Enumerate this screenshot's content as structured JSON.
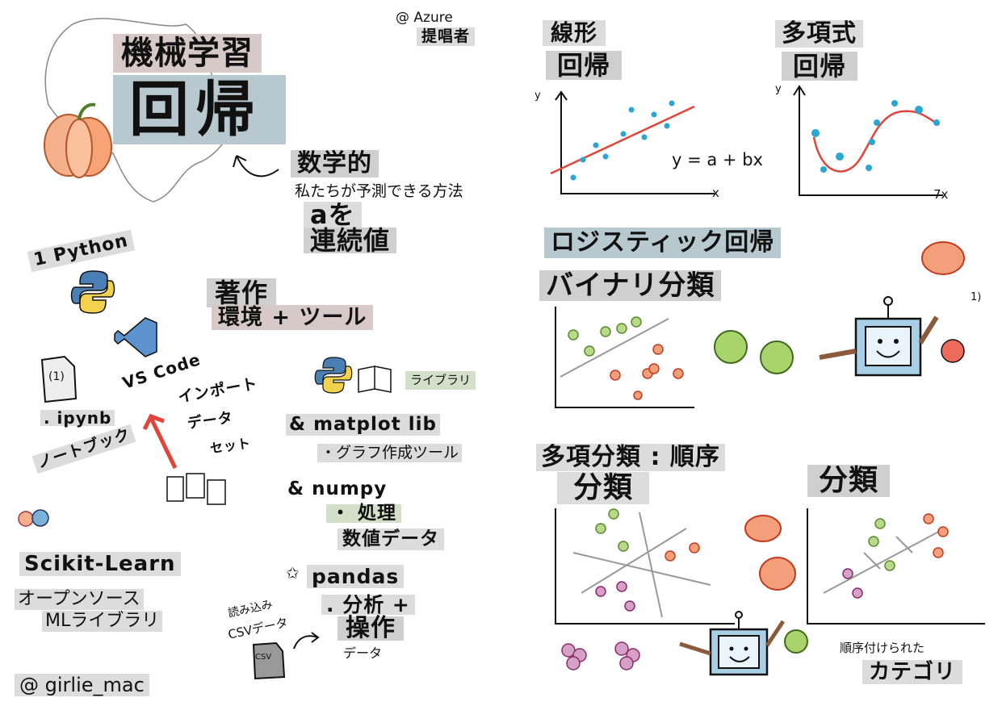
{
  "header": {
    "credit_azure": "@ Azure",
    "credit_azure_role": "提唱者",
    "title_small": "機械学習",
    "title_big": "回帰"
  },
  "definition": {
    "line1": "数学的",
    "line2": "私たちが予測できる方法",
    "line3": "aを",
    "line4": "連続値"
  },
  "linear": {
    "title1": "線形",
    "title2": "回帰",
    "formula": "y = a + bx",
    "axis_y": "y",
    "axis_x": "x"
  },
  "polynomial": {
    "title1": "多項式",
    "title2": "回帰",
    "axis_y": "y",
    "axis_x": "7x"
  },
  "logistic": {
    "title": "ロジスティック回帰",
    "binary": "バイナリ分類",
    "note": "1)"
  },
  "tools": {
    "python": "1 Python",
    "vscode": "VS Code",
    "notebook_ext": ". ipynb",
    "notebook_label": "ノートブック",
    "notebook_num": "(1)",
    "import1": "インポート",
    "import2": "データ",
    "import3": "セット",
    "env_title": "著作",
    "env_sub": "環境 + ツール",
    "library": "ライブラリ",
    "matplotlib": "& matplot lib",
    "matplotlib_desc": "・グラフ作成ツール",
    "numpy": "& numpy",
    "numpy_desc1": "・ 処理",
    "numpy_desc2": "数値データ",
    "pandas": "pandas",
    "pandas_desc1": ". 分析 +",
    "pandas_desc2": "操作",
    "pandas_desc3": "データ",
    "csv1": "読み込み",
    "csv2": "CSVデータ",
    "csv_icon": "CSV",
    "scikit": "Scikit-Learn",
    "scikit_desc1": "オープンソース",
    "scikit_desc2": "MLライブラリ",
    "author": "@ girlie_mac"
  },
  "multiclass": {
    "title": "多項分類 : 順序",
    "sub1": "分類",
    "sub2": "分類",
    "ordered1": "順序付けられた",
    "ordered2": "カテゴリ"
  },
  "colors": {
    "blue_dot": "#2aa6d6",
    "red_line": "#e0453a",
    "apple_green": "#8dc63f",
    "pumpkin_red": "#e8552d",
    "grape_purple": "#b0508a"
  }
}
